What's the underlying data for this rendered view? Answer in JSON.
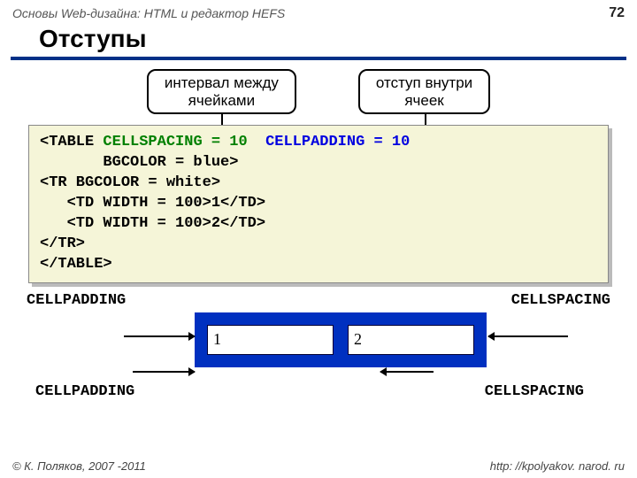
{
  "header": {
    "breadcrumb": "Основы Web-дизайна: HTML и редактор HEFS",
    "page": "72"
  },
  "title": "Отступы",
  "callout_left": "интервал между\nячейками",
  "callout_right": "отступ внутри\nячеек",
  "code": {
    "l1a": "<TABLE ",
    "l1b": "CELLSPACING = 10",
    "l1c": "CELLPADDING = 10",
    "l2": "       BGCOLOR = blue>",
    "l3": "<TR BGCOLOR = white>",
    "l4": "   <TD WIDTH = 100>1</TD>",
    "l5": "   <TD WIDTH = 100>2</TD>",
    "l6": "</TR>",
    "l7": "</TABLE>"
  },
  "labels": {
    "cp": "CELLPADDING",
    "cs": "CELLSPACING"
  },
  "cells": {
    "c1": "1",
    "c2": "2"
  },
  "footer": {
    "left": "© К. Поляков, 2007 -2011",
    "right": "http: //kpolyakov. narod. ru"
  }
}
